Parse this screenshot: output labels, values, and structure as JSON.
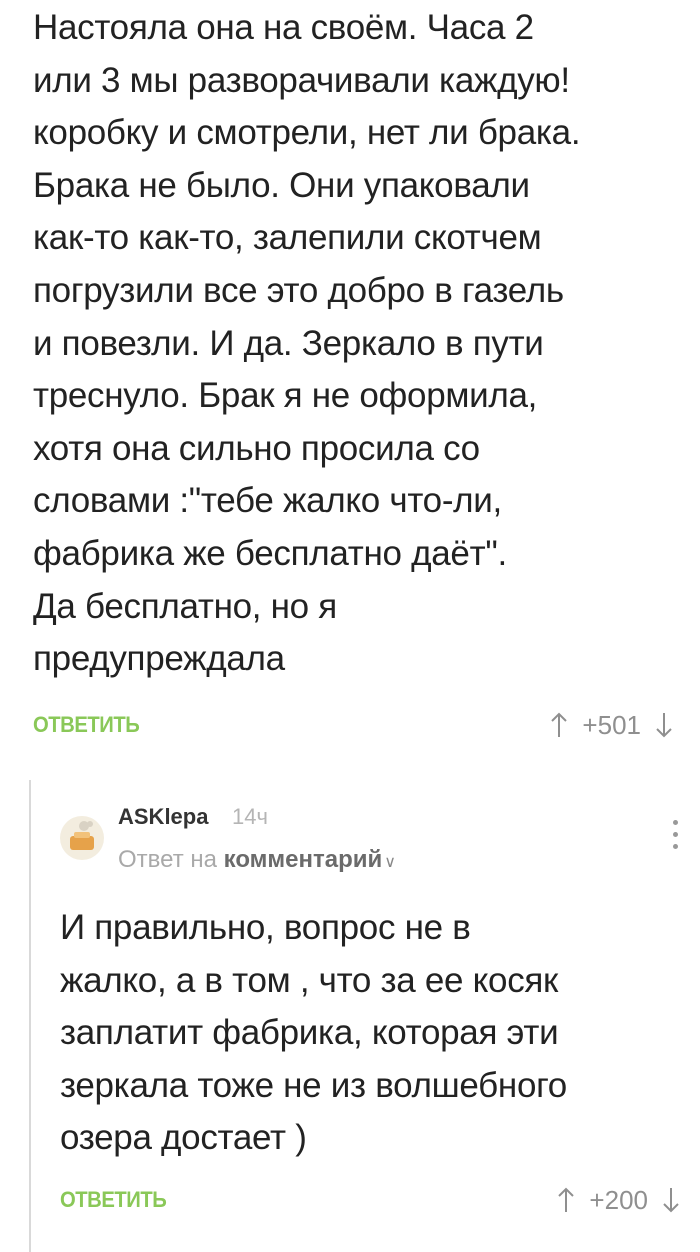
{
  "main_comment": {
    "lines": [
      "Настояла она на своём. Часа 2",
      "или 3 мы разворачивали каждую!",
      "коробку и смотрели, нет ли брака.",
      "Брака не было. Они упаковали",
      "как-то как-то, залепили скотчем",
      "погрузили все это добро в газель",
      "и повезли. И да. Зеркало в пути",
      "треснуло. Брак я не оформила,",
      "хотя она сильно просила со",
      "словами :\"тебе жалко что-ли,",
      "фабрика же бесплатно даёт\".",
      "Да бесплатно, но я",
      "предупреждала"
    ],
    "reply_label": "ОТВЕТИТЬ",
    "rating": "+501"
  },
  "reply_comment": {
    "author": "ASKlepa",
    "time": "14ч",
    "reply_to_prefix": "Ответ на",
    "reply_to_target": "комментарий",
    "lines": [
      "И правильно, вопрос не в",
      "жалко, а в том , что за ее косяк",
      "заплатит фабрика, которая эти",
      "зеркала тоже не из волшебного",
      "озера достает )"
    ],
    "reply_label": "ОТВЕТИТЬ",
    "rating": "+200"
  },
  "colors": {
    "accent_green": "#8ac858",
    "muted_gray": "#8f8f8f"
  },
  "icons": [
    "upvote-arrow-icon",
    "downvote-arrow-icon",
    "more-options-icon",
    "chevron-down-icon",
    "avatar"
  ]
}
